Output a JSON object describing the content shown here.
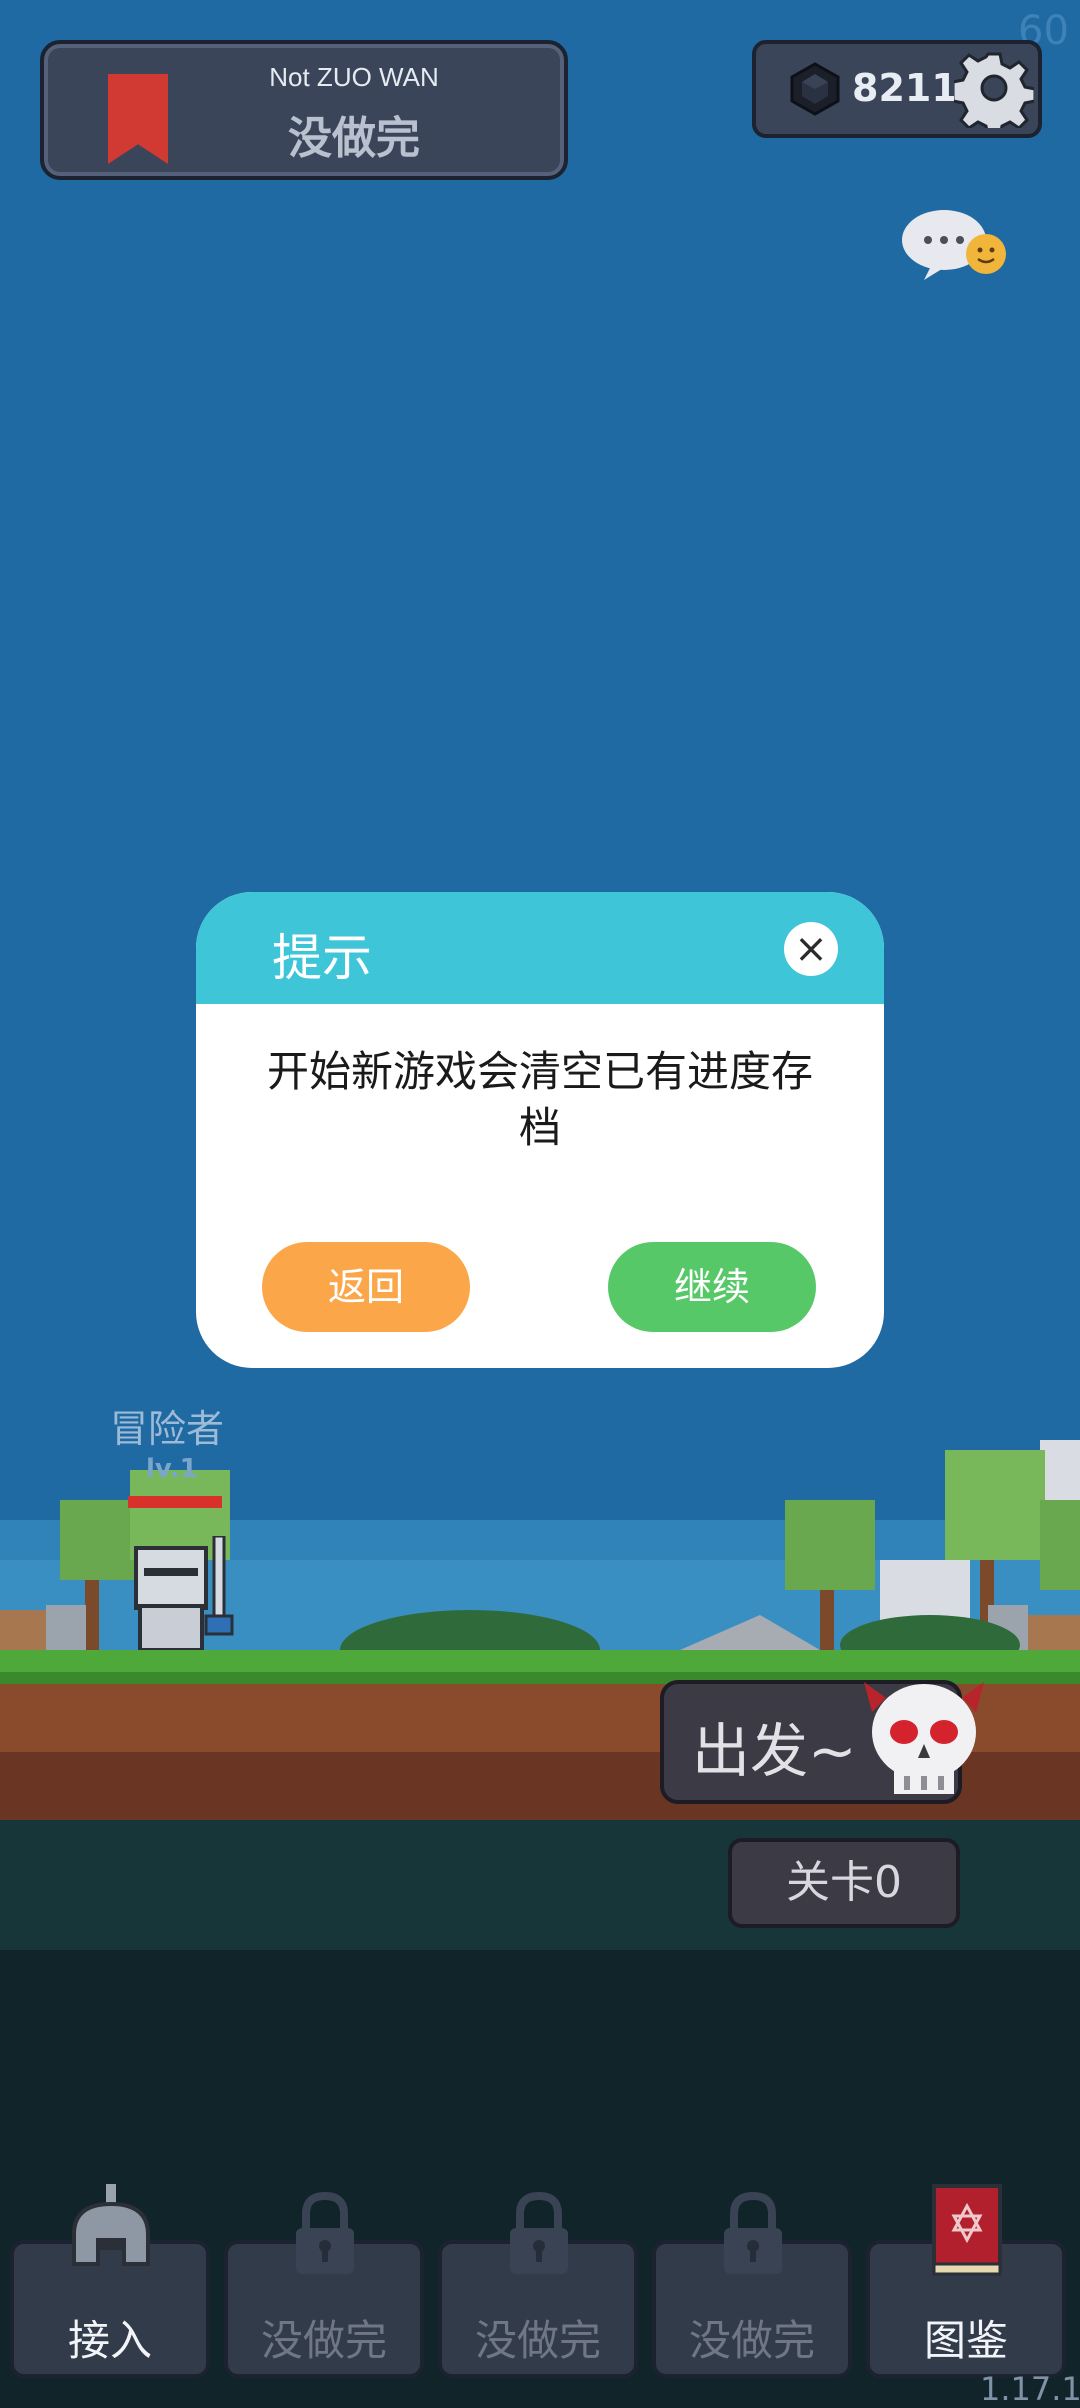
{
  "fps": "60",
  "header": {
    "title_en": "Not ZUO WAN",
    "title_cn": "没做完",
    "gem_count": "8211"
  },
  "dialog": {
    "title": "提示",
    "close": "×",
    "message": "开始新游戏会清空已有进度存档",
    "back_label": "返回",
    "continue_label": "继续"
  },
  "character": {
    "name": "冒险者",
    "level": "lv.1"
  },
  "actions": {
    "depart_label": "出发~",
    "stage_label": "关卡0"
  },
  "tabs": [
    {
      "label": "接入",
      "icon": "helmet-icon",
      "locked": false
    },
    {
      "label": "没做完",
      "icon": "lock-icon",
      "locked": true
    },
    {
      "label": "没做完",
      "icon": "lock-icon",
      "locked": true
    },
    {
      "label": "没做完",
      "icon": "lock-icon",
      "locked": true
    },
    {
      "label": "图鉴",
      "icon": "book-icon",
      "locked": false
    }
  ],
  "version": "1.17.1",
  "colors": {
    "sky": "#1f6aa3",
    "dialog_header": "#3ec6d8",
    "back_button": "#fca64a",
    "continue_button": "#57c868"
  }
}
